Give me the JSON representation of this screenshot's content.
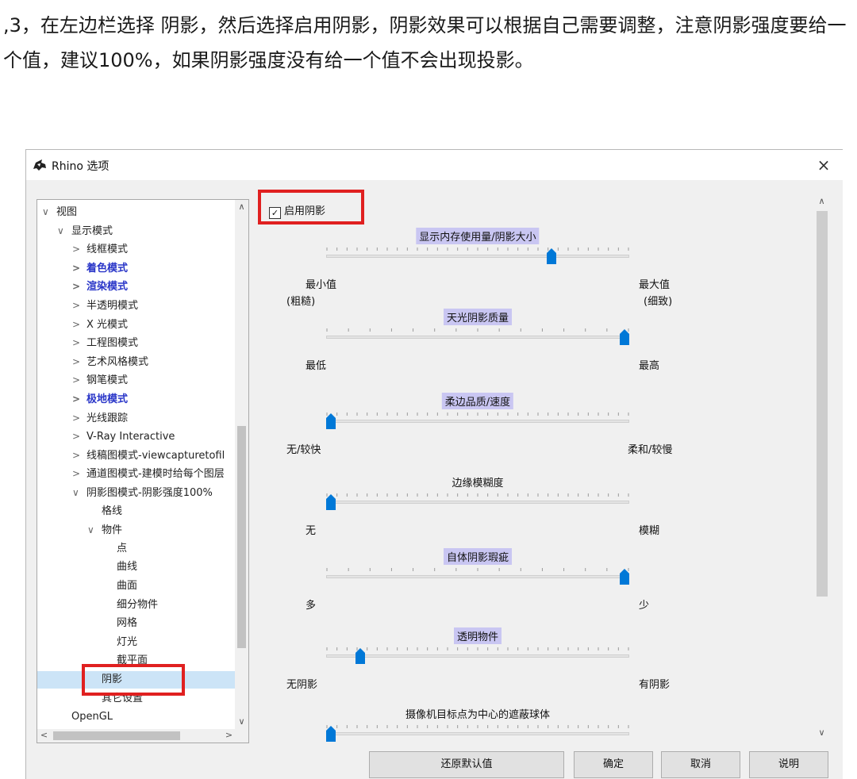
{
  "article": {
    "text": ",3，在左边栏选择 阴影，然后选择启用阴影，阴影效果可以根据自己需要调整，注意阴影强度要给一个值，建议100%，如果阴影强度没有给一个值不会出现投影。"
  },
  "window": {
    "title": "Rhino 选项",
    "close": "×"
  },
  "tree": {
    "items": [
      {
        "label": "视图",
        "arrow": "∨"
      },
      {
        "label": "显示模式",
        "arrow": "∨"
      },
      {
        "label": "线框模式",
        "arrow": ">"
      },
      {
        "label": "着色模式",
        "arrow": ">"
      },
      {
        "label": "渲染模式",
        "arrow": ">"
      },
      {
        "label": "半透明模式",
        "arrow": ">"
      },
      {
        "label": "X 光模式",
        "arrow": ">"
      },
      {
        "label": "工程图模式",
        "arrow": ">"
      },
      {
        "label": "艺术风格模式",
        "arrow": ">"
      },
      {
        "label": "钢笔模式",
        "arrow": ">"
      },
      {
        "label": "极地模式",
        "arrow": ">"
      },
      {
        "label": "光线跟踪",
        "arrow": ">"
      },
      {
        "label": "V-Ray Interactive",
        "arrow": ">"
      },
      {
        "label": "线稿图模式-viewcapturetofil",
        "arrow": ">"
      },
      {
        "label": "通道图模式-建模时给每个图层",
        "arrow": ">"
      },
      {
        "label": "阴影图模式-阴影强度100%",
        "arrow": "∨"
      },
      {
        "label": "格线",
        "arrow": ""
      },
      {
        "label": "物件",
        "arrow": "∨"
      },
      {
        "label": "点",
        "arrow": ""
      },
      {
        "label": "曲线",
        "arrow": ""
      },
      {
        "label": "曲面",
        "arrow": ""
      },
      {
        "label": "细分物件",
        "arrow": ""
      },
      {
        "label": "网格",
        "arrow": ""
      },
      {
        "label": "灯光",
        "arrow": ""
      },
      {
        "label": "截平面",
        "arrow": ""
      },
      {
        "label": "阴影",
        "arrow": ""
      },
      {
        "label": "其它设置",
        "arrow": ""
      },
      {
        "label": "OpenGL",
        "arrow": ""
      }
    ],
    "scroll_up": "∧",
    "scroll_down": "∨",
    "scroll_left": "<",
    "scroll_right": ">"
  },
  "shadow": {
    "enable_label": "启用阴影",
    "enable_checked": true,
    "sliders": [
      {
        "title": "显示内存使用量/阴影大小",
        "min_label": "最小值",
        "min_sub": "(粗糙)",
        "max_label": "最大值",
        "max_sub": "(细致)",
        "value": 0.75
      },
      {
        "title": "天光阴影质量",
        "min_label": "最低",
        "min_sub": "",
        "max_label": "最高",
        "max_sub": "",
        "value": 1.0
      },
      {
        "title": "柔边品质/速度",
        "min_label": "无/较快",
        "min_sub": "",
        "max_label": "柔和/较慢",
        "max_sub": "",
        "value": 0.0
      },
      {
        "title": "边缘模糊度",
        "min_label": "无",
        "min_sub": "",
        "max_label": "模糊",
        "max_sub": "",
        "value": 0.0
      },
      {
        "title": "自体阴影瑕疵",
        "min_label": "多",
        "min_sub": "",
        "max_label": "少",
        "max_sub": "",
        "value": 1.0
      },
      {
        "title": "透明物件",
        "min_label": "无阴影",
        "min_sub": "",
        "max_label": "有阴影",
        "max_sub": "",
        "value": 0.1
      },
      {
        "title": "摄像机目标点为中心的遮蔽球体",
        "min_label": "",
        "min_sub": "",
        "max_label": "",
        "max_sub": "",
        "value": 0.0
      }
    ],
    "scroll_up": "∧",
    "scroll_down": "∨"
  },
  "buttons": {
    "restore": "还原默认值",
    "ok": "确定",
    "cancel": "取消",
    "help": "说明"
  },
  "colors": {
    "highlight": "#c9c6f2",
    "accent": "#0078d7",
    "annotation": "#e02020"
  }
}
